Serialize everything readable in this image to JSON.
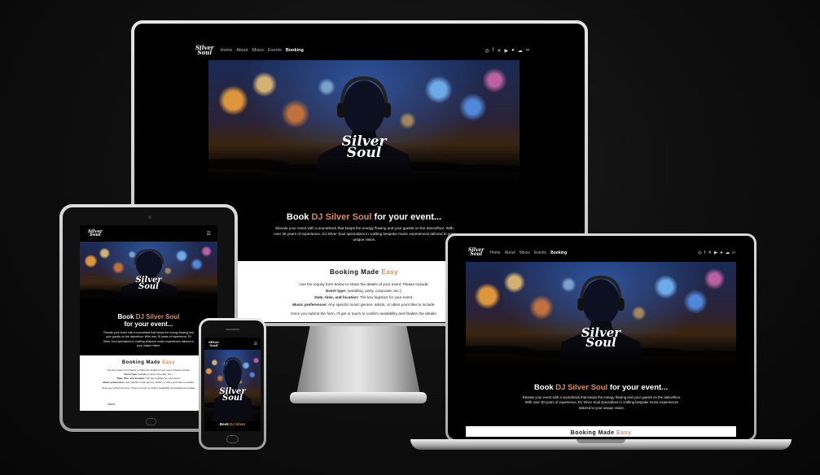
{
  "site": {
    "logo_line1": "Silver",
    "logo_line2": "Soul",
    "logo_prefix": "DJ",
    "nav": {
      "home": "Home",
      "about": "About",
      "mixes": "Mixes",
      "events": "Events",
      "booking": "Booking"
    },
    "social": {
      "instagram": "instagram-icon",
      "facebook": "facebook-icon",
      "x": "x-icon",
      "youtube": "youtube-icon",
      "spotify": "spotify-icon",
      "soundcloud": "soundcloud-icon",
      "mixcloud": "mixcloud-icon"
    },
    "hero_title_pre": "Book",
    "hero_title_accent": "DJ Silver Soul",
    "hero_title_post": "for your event...",
    "hero_sub": "Elevate your event with a soundtrack that keeps the energy flowing and your guests on the dancefloor. With over 30 years of experience, DJ Silver Soul specializes in crafting bespoke music experiences tailored to your unique vision.",
    "booking_heading_pre": "Booking Made",
    "booking_heading_accent": "Easy",
    "booking_intro": "Use the inquiry form below to share the details of your event. Please include:",
    "event_type_label": "Event type:",
    "event_type_text": "(wedding, party, corporate, etc.).",
    "date_label": "Date, time, and location:",
    "date_text": "The key logistics for your event.",
    "music_label": "Music preferences:",
    "music_text": "Any specific music genres, artists, or vibes you'd like to include.",
    "outro": "Once you submit the form, I'll get in touch to confirm availability and finalize the details.",
    "form_name_label": "Name",
    "phone_title_pre": "Book",
    "phone_title_accent": "DJ Silver"
  },
  "colors": {
    "accent": "#d98a5b",
    "background": "#000000",
    "section_white": "#ffffff"
  }
}
